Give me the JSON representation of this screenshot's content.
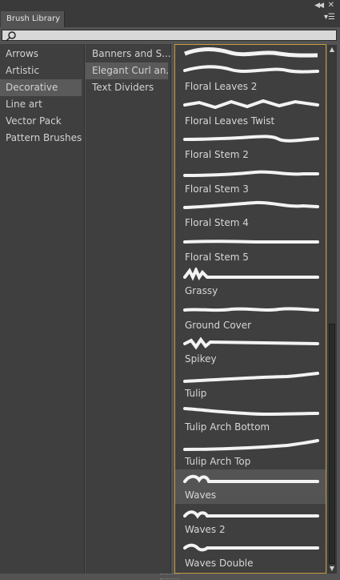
{
  "panel": {
    "tab_label": "Brush Library",
    "search": {
      "value": ""
    }
  },
  "categories": [
    "Arrows",
    "Artistic",
    "Decorative",
    "Line art",
    "Vector Pack",
    "Pattern Brushes"
  ],
  "selected_category": "Decorative",
  "subcategories": [
    "Banners and S...",
    "Elegant Curl an...",
    "Text Dividers"
  ],
  "selected_subcategory": "Elegant Curl an...",
  "brushes": [
    "Floral Leaves 2",
    "Floral Leaves Twist",
    "Floral Stem 2",
    "Floral Stem 3",
    "Floral Stem 4",
    "Floral Stem 5",
    "Grassy",
    "Ground Cover",
    "Spikey",
    "Tulip",
    "Tulip Arch Bottom",
    "Tulip Arch Top",
    "Waves",
    "Waves 2",
    "Waves Double"
  ],
  "selected_brush": "Waves",
  "colors": {
    "panel_bg": "#535353",
    "list_bg": "#3f3f3f",
    "accent_border": "#c39a3a",
    "search_bg": "#d8d8d8"
  },
  "icons": [
    "collapse-icon",
    "close-icon",
    "panel-menu-icon",
    "search-icon",
    "scroll-up-arrow",
    "scroll-down-arrow",
    "resize-grip"
  ]
}
